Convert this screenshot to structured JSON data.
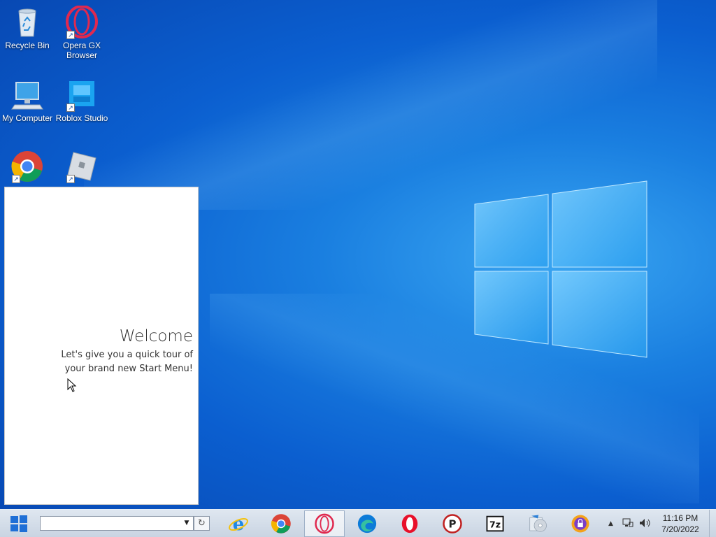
{
  "desktop": {
    "icons": [
      {
        "label": "Recycle Bin",
        "icon": "recycle-bin-icon"
      },
      {
        "label": "Opera GX Browser",
        "icon": "opera-gx-icon"
      },
      {
        "label": "My Computer",
        "icon": "computer-icon"
      },
      {
        "label": "Roblox Studio",
        "icon": "roblox-studio-icon"
      },
      {
        "label": "",
        "icon": "chrome-icon"
      },
      {
        "label": "",
        "icon": "roblox-icon"
      }
    ]
  },
  "welcome": {
    "title": "Welcome",
    "subtitle": "Let's give you a quick tour of your brand new Start Menu!"
  },
  "taskbar": {
    "address_value": "",
    "apps": [
      {
        "name": "internet-explorer",
        "icon": "internet-explorer-icon"
      },
      {
        "name": "chrome",
        "icon": "chrome-icon"
      },
      {
        "name": "opera-gx",
        "icon": "opera-gx-icon",
        "active": true
      },
      {
        "name": "edge",
        "icon": "edge-icon"
      },
      {
        "name": "opera",
        "icon": "opera-icon"
      },
      {
        "name": "p-app",
        "icon": "p-app-icon"
      },
      {
        "name": "7zip",
        "icon": "7zip-icon"
      },
      {
        "name": "disc-tool",
        "icon": "disc-icon"
      },
      {
        "name": "vpn-lock",
        "icon": "lock-icon"
      }
    ],
    "tray": {
      "time": "11:16 PM",
      "date": "7/20/2022"
    }
  },
  "colors": {
    "wallpaper": "#0b5fd0",
    "taskbar": "#cfd9e6",
    "panel": "#ffffff"
  }
}
